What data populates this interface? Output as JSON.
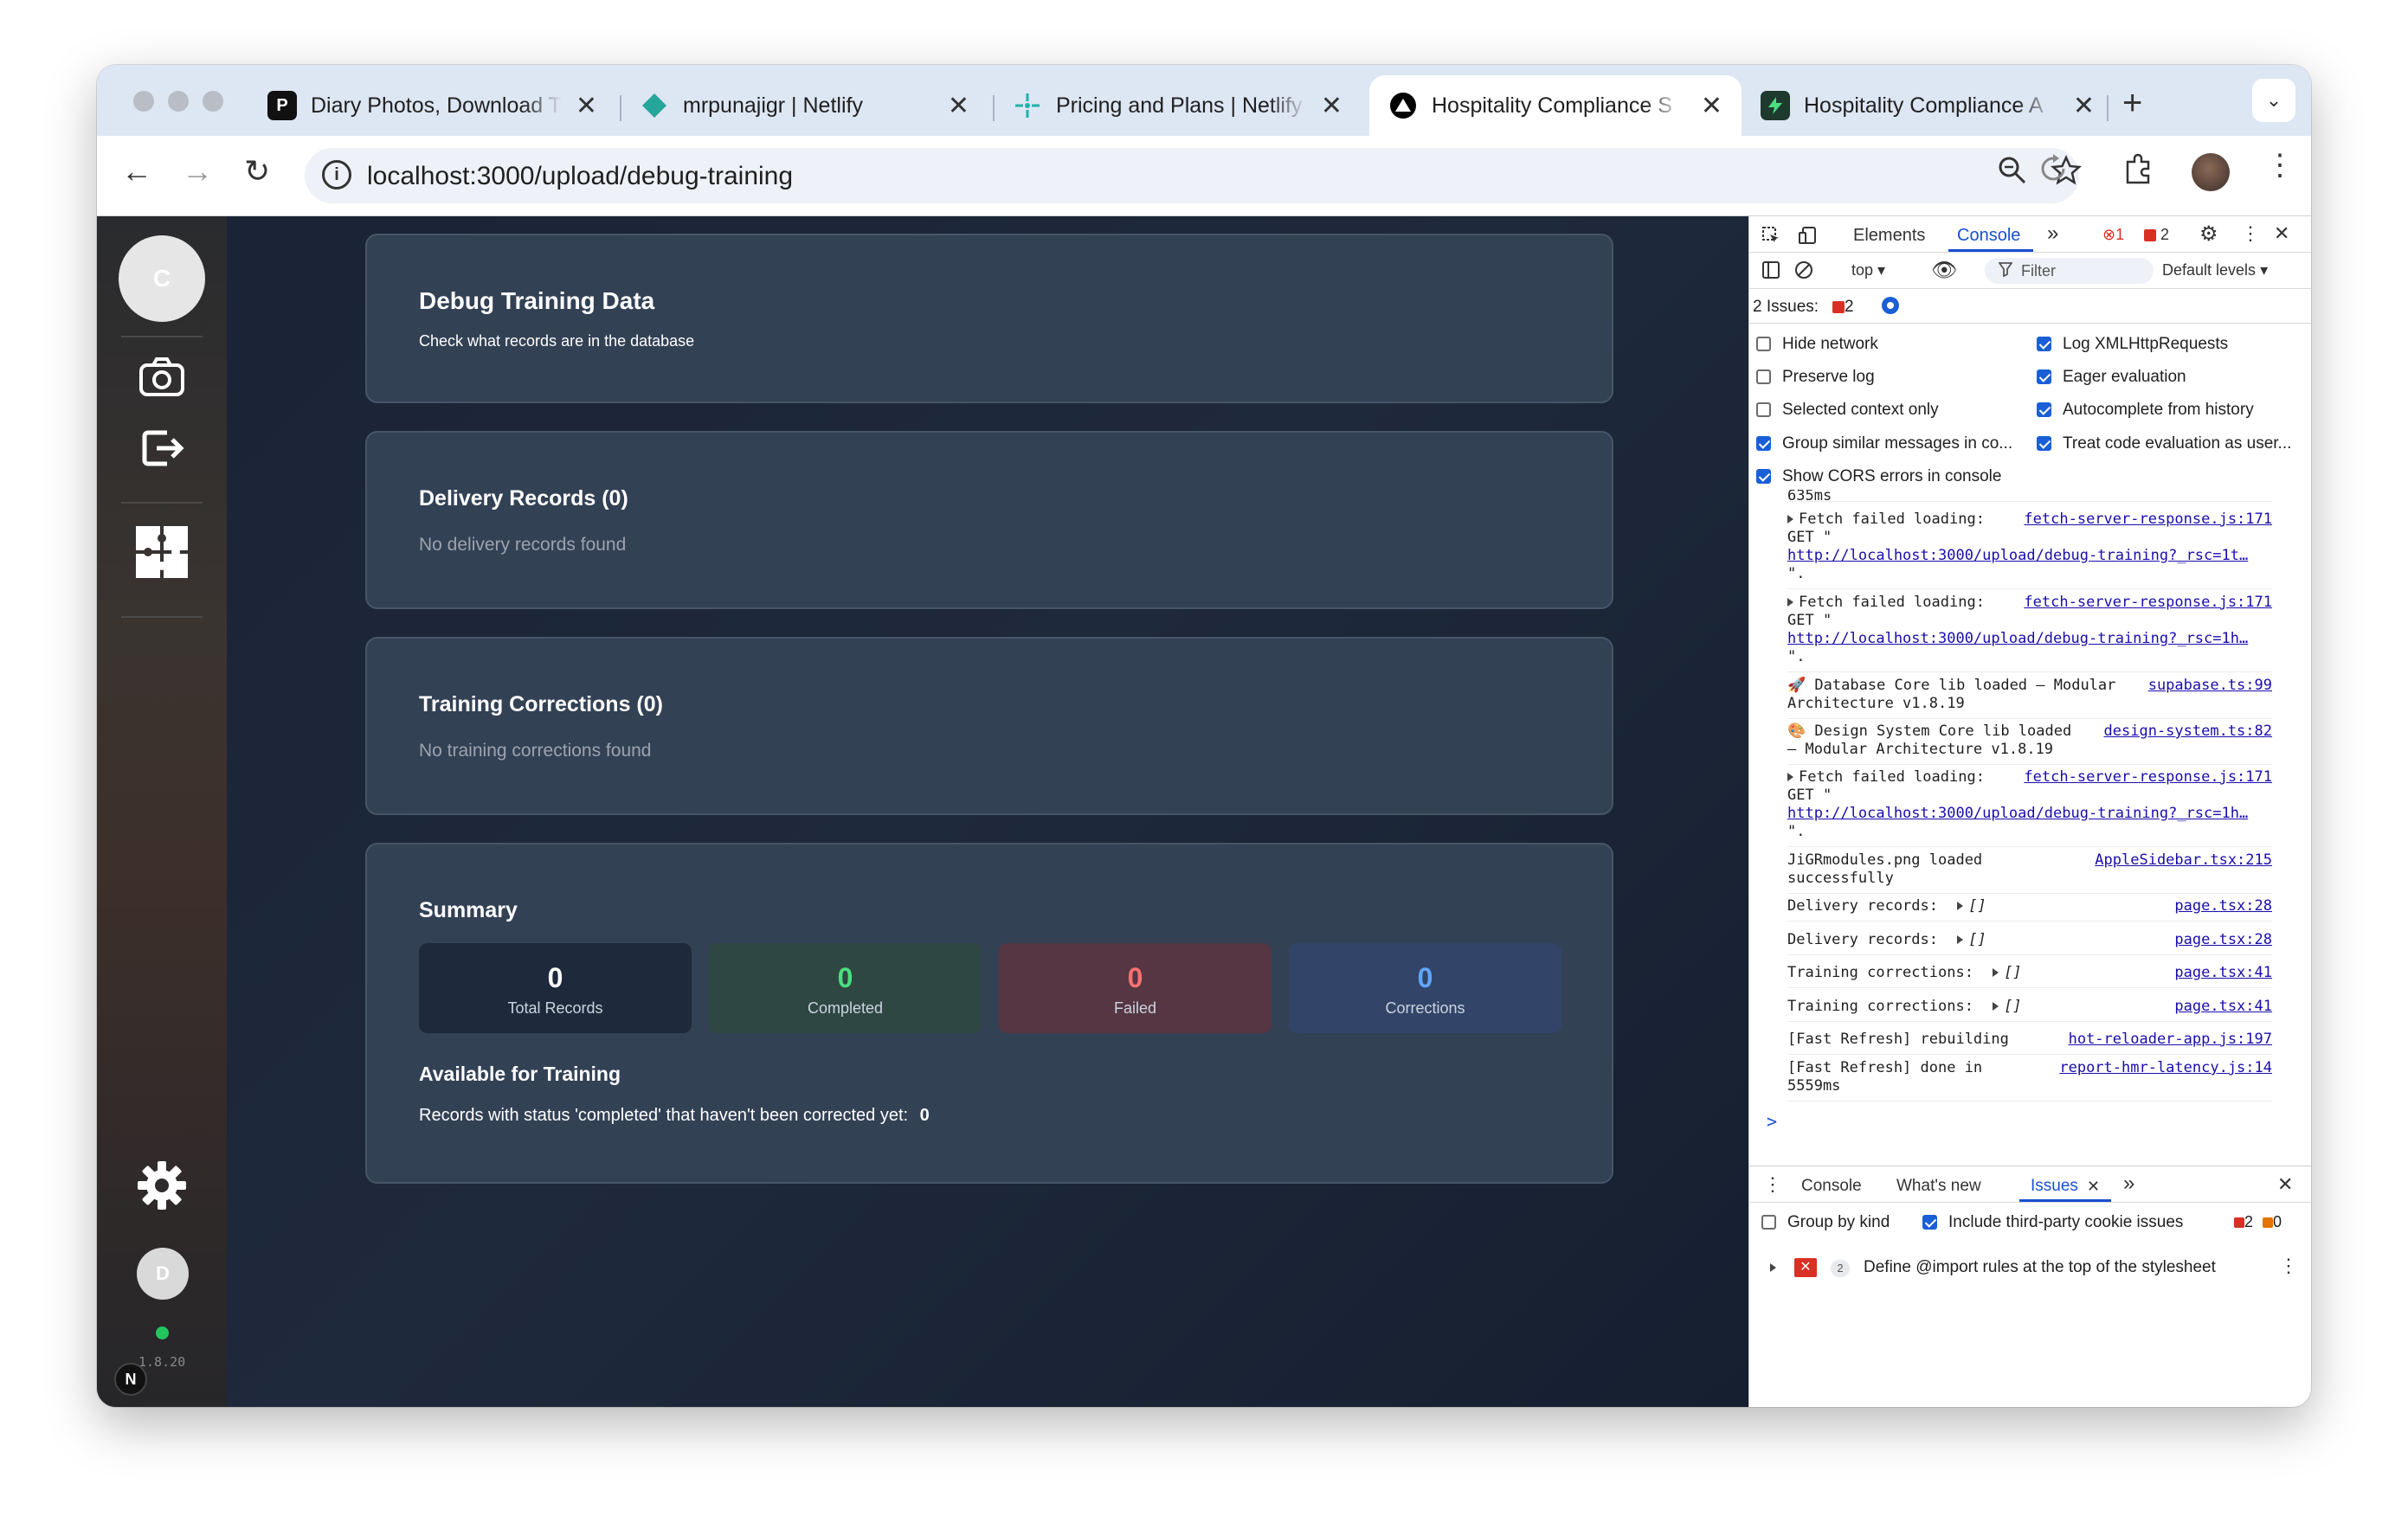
{
  "browser": {
    "tabs": [
      {
        "title": "Diary Photos, Download T",
        "favicon": "P"
      },
      {
        "title": "mrpunajigr | Netlify",
        "favicon": ""
      },
      {
        "title": "Pricing and Plans | Netlify",
        "favicon": ""
      },
      {
        "title": "Hospitality Compliance S",
        "favicon": ""
      },
      {
        "title": "Hospitality Compliance A",
        "favicon": ""
      }
    ],
    "url": "localhost:3000/upload/debug-training"
  },
  "sidebar": {
    "avatar_initial": "C",
    "user_initial": "D",
    "version": "1.8.20",
    "next_badge": "N"
  },
  "main": {
    "header": {
      "title": "Debug Training Data",
      "subtitle": "Check what records are in the database"
    },
    "delivery": {
      "title": "Delivery Records (0)",
      "empty": "No delivery records found"
    },
    "corrections": {
      "title": "Training Corrections (0)",
      "empty": "No training corrections found"
    },
    "summary": {
      "title": "Summary",
      "stats": [
        {
          "value": "0",
          "label": "Total Records",
          "color": "#ffffff"
        },
        {
          "value": "0",
          "label": "Completed",
          "color": "#4ade80"
        },
        {
          "value": "0",
          "label": "Failed",
          "color": "#f87171"
        },
        {
          "value": "0",
          "label": "Corrections",
          "color": "#60a5fa"
        }
      ],
      "available_title": "Available for Training",
      "available_text": "Records with status 'completed' that haven't been corrected yet:",
      "available_count": "0"
    }
  },
  "devtools": {
    "tabs": [
      "Elements",
      "Console"
    ],
    "error_count": "1",
    "issue_count": "2",
    "context": "top",
    "filter_placeholder": "Filter",
    "levels": "Default levels",
    "issues_label": "2 Issues:",
    "issues_badge": "2",
    "options_left": [
      {
        "label": "Hide network",
        "checked": false
      },
      {
        "label": "Preserve log",
        "checked": false
      },
      {
        "label": "Selected context only",
        "checked": false
      },
      {
        "label": "Group similar messages in co...",
        "checked": true
      },
      {
        "label": "Show CORS errors in console",
        "checked": true
      }
    ],
    "options_right": [
      {
        "label": "Log XMLHttpRequests",
        "checked": true
      },
      {
        "label": "Eager evaluation",
        "checked": true
      },
      {
        "label": "Autocomplete from history",
        "checked": true
      },
      {
        "label": "Treat code evaluation as user...",
        "checked": true
      }
    ],
    "logs": {
      "top_clip": "635ms",
      "fetch1": {
        "msg": "Fetch failed loading:",
        "src": "fetch-server-response.js:171",
        "line2": "GET \"",
        "url": "http://localhost:3000/upload/debug-training?_rsc=1t…",
        "line4": "\"."
      },
      "fetch2": {
        "msg": "Fetch failed loading:",
        "src": "fetch-server-response.js:171",
        "line2": "GET \"",
        "url": "http://localhost:3000/upload/debug-training?_rsc=1h…",
        "line4": "\"."
      },
      "db": {
        "msg": "🚀 Database Core lib loaded – Modular",
        "src": "supabase.ts:99",
        "line2": "Architecture v1.8.19"
      },
      "ds": {
        "msg": "🎨 Design System Core lib loaded",
        "src": "design-system.ts:82",
        "line2": "– Modular Architecture v1.8.19"
      },
      "fetch3": {
        "msg": "Fetch failed loading:",
        "src": "fetch-server-response.js:171",
        "line2": "GET \"",
        "url": "http://localhost:3000/upload/debug-training?_rsc=1h…",
        "line4": "\"."
      },
      "png": {
        "msg": "JiGRmodules.png loaded",
        "src": "AppleSidebar.tsx:215",
        "line2": "successfully"
      },
      "dr1": {
        "msg": "Delivery records:",
        "val": "[]",
        "src": "page.tsx:28"
      },
      "dr2": {
        "msg": "Delivery records:",
        "val": "[]",
        "src": "page.tsx:28"
      },
      "tc1": {
        "msg": "Training corrections:",
        "val": "[]",
        "src": "page.tsx:41"
      },
      "tc2": {
        "msg": "Training corrections:",
        "val": "[]",
        "src": "page.tsx:41"
      },
      "fr1": {
        "msg": "[Fast Refresh] rebuilding",
        "src": "hot-reloader-app.js:197"
      },
      "fr2": {
        "msg": "[Fast Refresh] done in",
        "src": "report-hmr-latency.js:14",
        "line2": "5559ms"
      },
      "prompt": ">"
    },
    "drawer": {
      "tabs": [
        "Console",
        "What's new",
        "Issues"
      ],
      "group_by_kind": "Group by kind",
      "include_third_party": "Include third-party cookie issues",
      "err_count": "2",
      "warn_count": "0",
      "issue_count": "2",
      "issue_text": "Define @import rules at the top of the stylesheet"
    }
  }
}
